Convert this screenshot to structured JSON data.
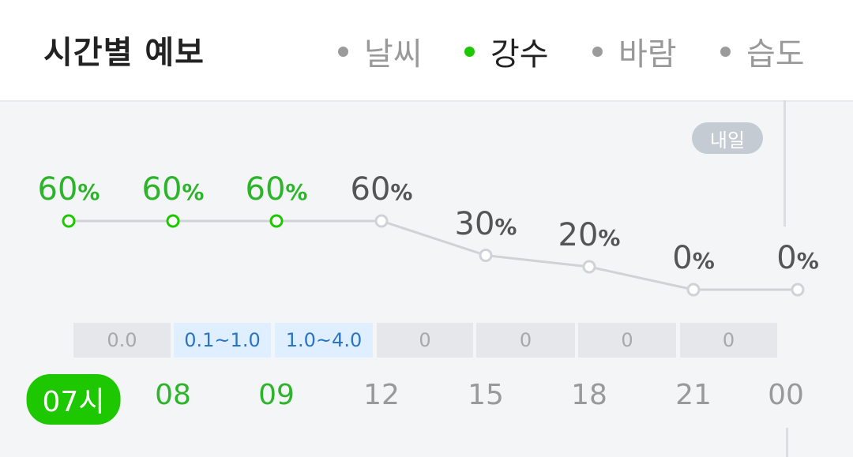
{
  "header": {
    "title": "시간별 예보",
    "tabs": [
      {
        "label": "날씨",
        "active": false
      },
      {
        "label": "강수",
        "active": true
      },
      {
        "label": "바람",
        "active": false
      },
      {
        "label": "습도",
        "active": false
      }
    ]
  },
  "badge": {
    "tomorrow": "내일"
  },
  "forecast": [
    {
      "hour": "07시",
      "percent": "60",
      "amount": "0.0",
      "highlight": true,
      "now": true,
      "amount_blue": false
    },
    {
      "hour": "08",
      "percent": "60",
      "amount": "0.1~1.0",
      "highlight": true,
      "now": false,
      "amount_blue": true
    },
    {
      "hour": "09",
      "percent": "60",
      "amount": "1.0~4.0",
      "highlight": true,
      "now": false,
      "amount_blue": true
    },
    {
      "hour": "12",
      "percent": "60",
      "amount": "0",
      "highlight": false,
      "now": false,
      "amount_blue": false
    },
    {
      "hour": "15",
      "percent": "30",
      "amount": "0",
      "highlight": false,
      "now": false,
      "amount_blue": false
    },
    {
      "hour": "18",
      "percent": "20",
      "amount": "0",
      "highlight": false,
      "now": false,
      "amount_blue": false
    },
    {
      "hour": "21",
      "percent": "0",
      "amount": "0",
      "highlight": false,
      "now": false,
      "amount_blue": false
    },
    {
      "hour": "00",
      "percent": "0",
      "amount": null,
      "highlight": false,
      "now": false,
      "amount_blue": false
    }
  ],
  "percent_unit": "%",
  "colors": {
    "accent": "#1ec800",
    "highlight_text": "#2cb52a",
    "line_gray": "#cfd2d6",
    "amount_blue_bg": "#e0efff",
    "amount_blue_text": "#2a74c4"
  }
}
